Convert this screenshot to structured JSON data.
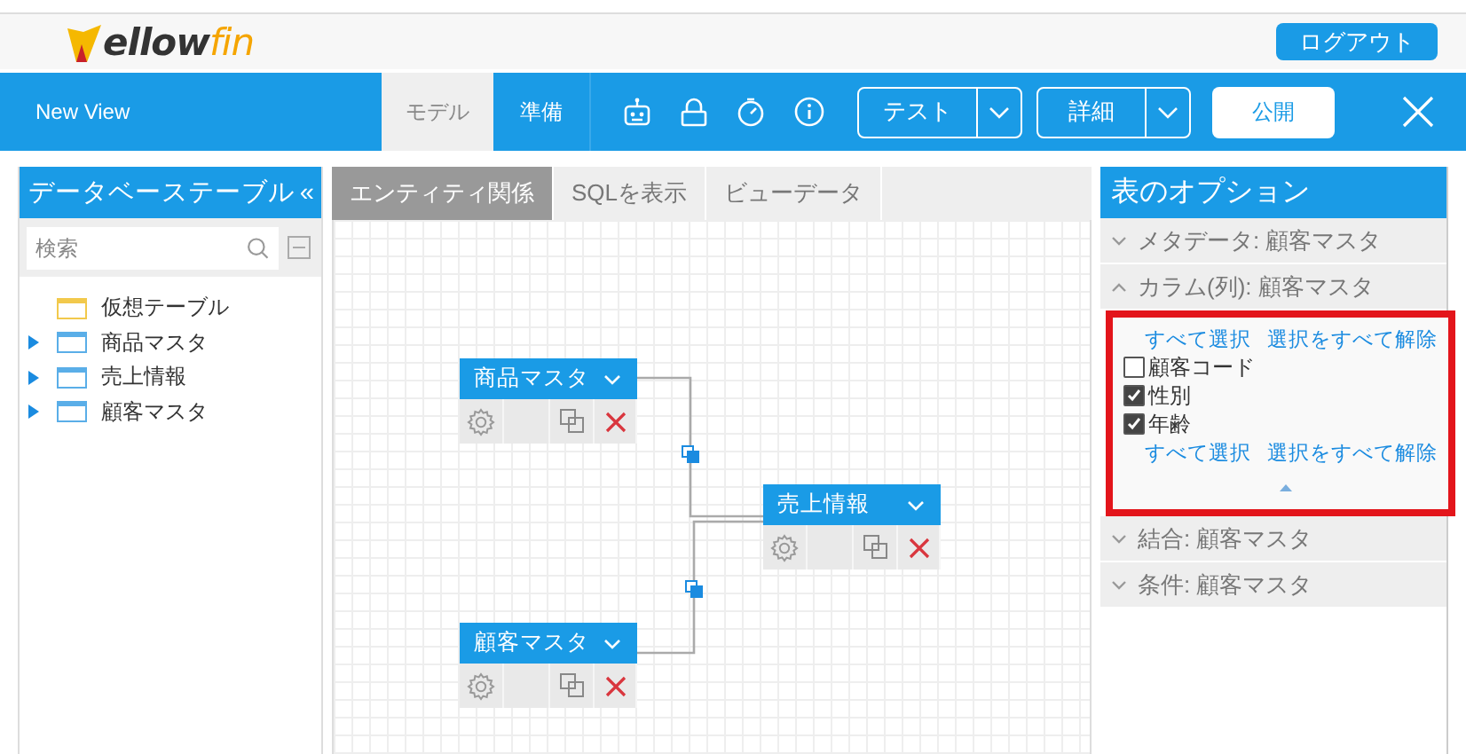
{
  "header": {
    "logo": {
      "text": "ellow",
      "accent": "fin"
    },
    "logout": "ログアウト"
  },
  "toolbar": {
    "title": "New View",
    "tabs": [
      {
        "label": "モデル",
        "selected": true
      },
      {
        "label": "準備",
        "selected": false
      }
    ],
    "buttons": [
      {
        "label": "テスト",
        "kind": "split"
      },
      {
        "label": "詳細",
        "kind": "split"
      },
      {
        "label": "公開",
        "kind": "primary"
      }
    ]
  },
  "left_panel": {
    "title": "データベーステーブル",
    "collapse": "«",
    "search": {
      "placeholder": "検索"
    },
    "tree": [
      {
        "label": "仮想テーブル",
        "kind": "virtual"
      },
      {
        "label": "商品マスタ",
        "kind": "table",
        "expanded": false
      },
      {
        "label": "売上情報",
        "kind": "table",
        "expanded": false
      },
      {
        "label": "顧客マスタ",
        "kind": "table",
        "expanded": false
      }
    ]
  },
  "center": {
    "tabs": [
      {
        "label": "エンティティ関係",
        "selected": true
      },
      {
        "label": "SQLを表示",
        "selected": false
      },
      {
        "label": "ビューデータ",
        "selected": false
      }
    ],
    "entities": [
      {
        "name": "商品マスタ"
      },
      {
        "name": "売上情報"
      },
      {
        "name": "顧客マスタ"
      }
    ]
  },
  "options": {
    "title": "表のオプション",
    "sections": [
      {
        "label": "メタデータ: 顧客マスタ",
        "expanded": false
      },
      {
        "label": "カラム(列): 顧客マスタ",
        "expanded": true,
        "highlighted": true,
        "links": [
          "すべて選択",
          "選択をすべて解除"
        ],
        "columns": [
          {
            "label": "顧客コード",
            "checked": false
          },
          {
            "label": "性別",
            "checked": true
          },
          {
            "label": "年齢",
            "checked": true
          }
        ],
        "footer_links": [
          "すべて選択",
          "選択をすべて解除"
        ]
      },
      {
        "label": "結合: 顧客マスタ",
        "expanded": false
      },
      {
        "label": "条件: 顧客マスタ",
        "expanded": false
      }
    ]
  }
}
